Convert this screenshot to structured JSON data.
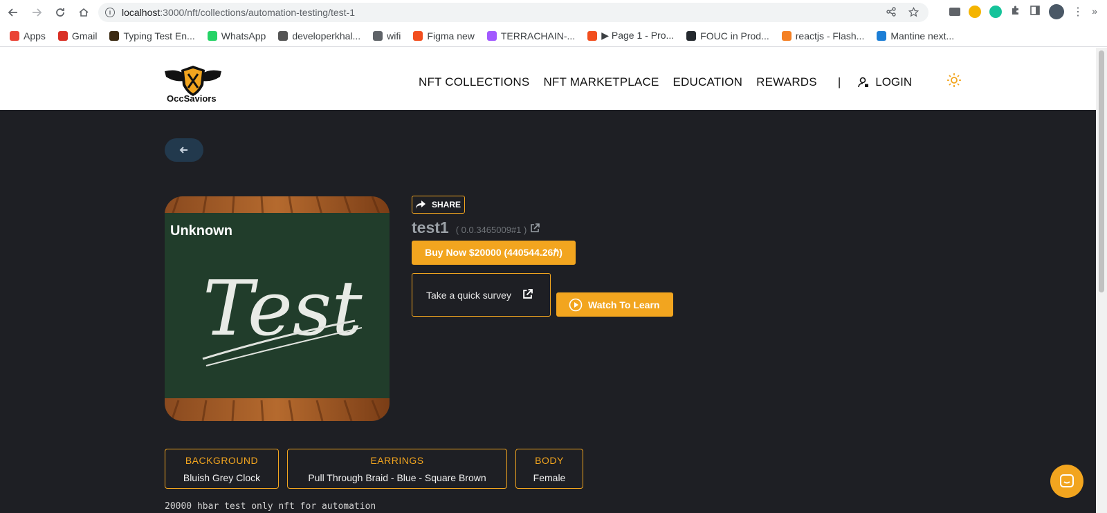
{
  "browser": {
    "url_host": "localhost",
    "url_rest": ":3000/nft/collections/automation-testing/test-1",
    "bookmarks": [
      {
        "label": "Apps",
        "color": "#ea4335"
      },
      {
        "label": "Gmail",
        "color": "#d93025"
      },
      {
        "label": "Typing Test En...",
        "color": "#3c2a12"
      },
      {
        "label": "WhatsApp",
        "color": "#25d366"
      },
      {
        "label": "developerkhal...",
        "color": "#555555"
      },
      {
        "label": "wifi",
        "color": "#5f6368"
      },
      {
        "label": "Figma new",
        "color": "#f24e1e"
      },
      {
        "label": "TERRACHAIN-...",
        "color": "#a259ff"
      },
      {
        "label": "▶ Page 1 - Pro...",
        "color": "#f24e1e"
      },
      {
        "label": "FOUC in Prod...",
        "color": "#24292e"
      },
      {
        "label": "reactjs - Flash...",
        "color": "#f48024"
      },
      {
        "label": "Mantine next...",
        "color": "#1c7ed6"
      }
    ]
  },
  "header": {
    "logo_text": "OccSaviors",
    "nav": [
      "NFT COLLECTIONS",
      "NFT MARKETPLACE",
      "EDUCATION",
      "REWARDS"
    ],
    "separator": "|",
    "login": "LOGIN"
  },
  "nft": {
    "image_label": "Unknown",
    "image_text": "Test",
    "share": "SHARE",
    "title": "test1",
    "token_id": "( 0.0.3465009#1 )",
    "buy_label": "Buy Now $20000 (440544.26ℏ)",
    "survey_label": "Take a quick survey",
    "watch_label": "Watch To Learn",
    "attributes": [
      {
        "key": "BACKGROUND",
        "value": "Bluish Grey Clock"
      },
      {
        "key": "EARRINGS",
        "value": "Pull Through Braid - Blue - Square Brown"
      },
      {
        "key": "BODY",
        "value": "Female"
      }
    ],
    "description": "20000 hbar test only nft for automation"
  },
  "colors": {
    "accent": "#f2a51f",
    "page_bg": "#1e1f24"
  }
}
